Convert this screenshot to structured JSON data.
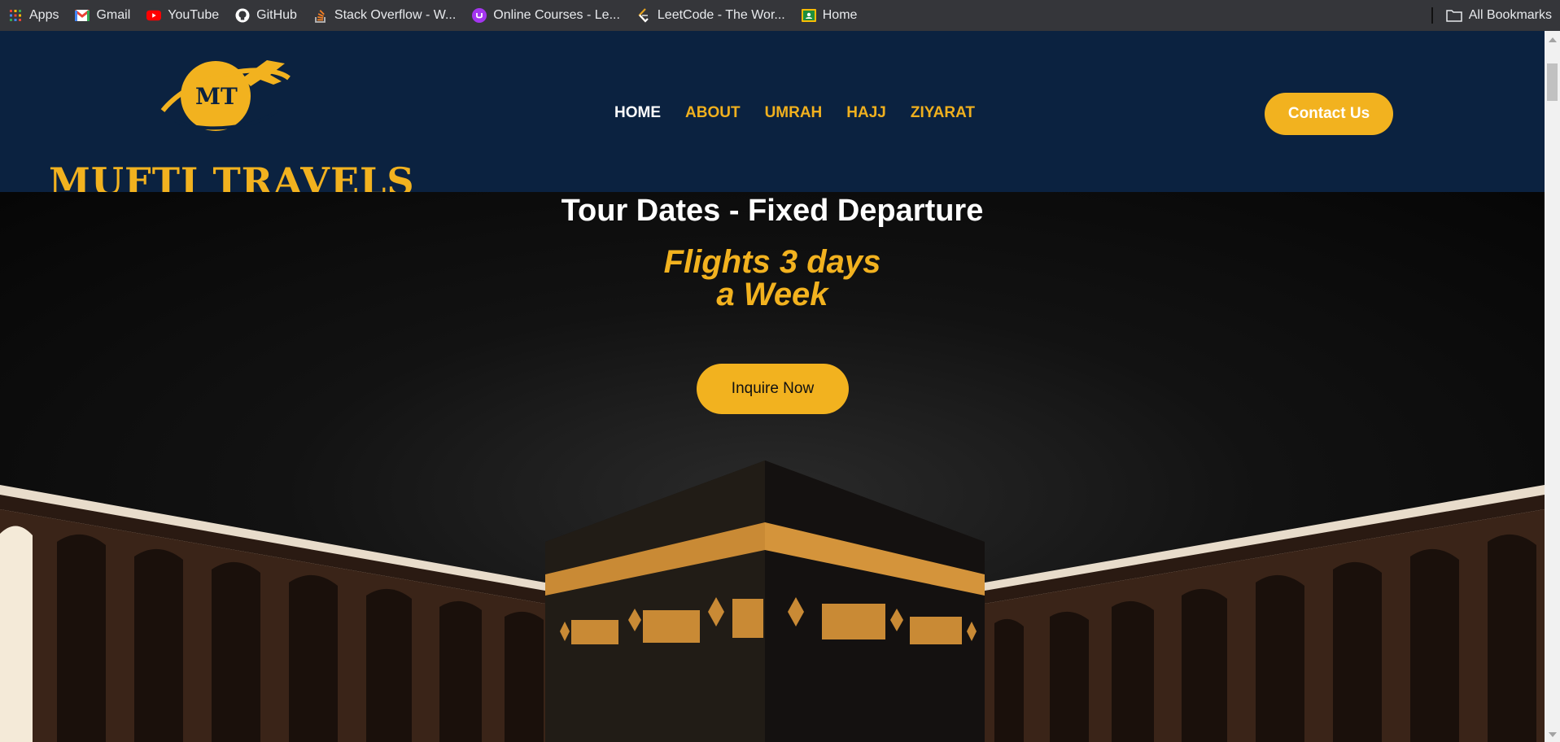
{
  "bookmarks": {
    "items": [
      {
        "label": "Apps",
        "icon": "apps-grid-icon"
      },
      {
        "label": "Gmail",
        "icon": "gmail-icon"
      },
      {
        "label": "YouTube",
        "icon": "youtube-icon"
      },
      {
        "label": "GitHub",
        "icon": "github-icon"
      },
      {
        "label": "Stack Overflow - W...",
        "icon": "stackoverflow-icon"
      },
      {
        "label": "Online Courses - Le...",
        "icon": "udemy-icon"
      },
      {
        "label": "LeetCode - The Wor...",
        "icon": "leetcode-icon"
      },
      {
        "label": "Home",
        "icon": "classroom-icon"
      }
    ],
    "all_bookmarks_label": "All Bookmarks"
  },
  "header": {
    "logo_monogram": "MT",
    "logo_text": "MUFTI TRAVELS",
    "nav": [
      {
        "label": "HOME",
        "active": true
      },
      {
        "label": "ABOUT",
        "active": false
      },
      {
        "label": "UMRAH",
        "active": false
      },
      {
        "label": "HAJJ",
        "active": false
      },
      {
        "label": "ZIYARAT",
        "active": false
      }
    ],
    "contact_label": "Contact Us"
  },
  "hero": {
    "title": "Tour Dates - Fixed Departure",
    "subtitle_line1": "Flights 3 days",
    "subtitle_line2": "a Week",
    "cta_label": "Inquire Now"
  },
  "colors": {
    "accent": "#f2b21f",
    "header_bg": "#0b2240",
    "bookmarks_bg": "#35363a"
  }
}
